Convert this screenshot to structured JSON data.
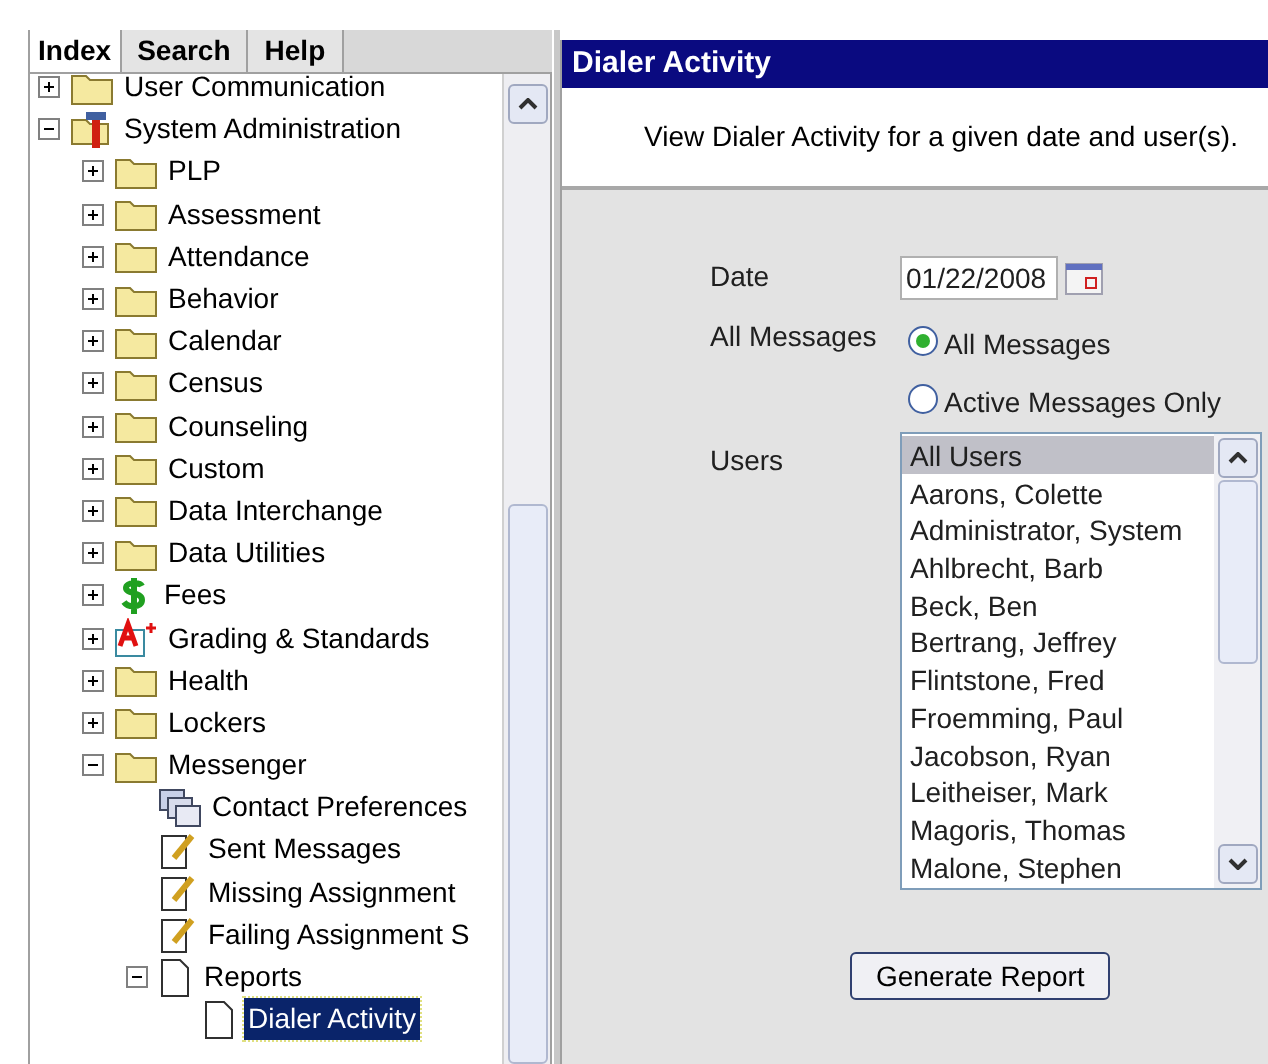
{
  "tabs": [
    {
      "label": "Index",
      "selected": true
    },
    {
      "label": "Search",
      "selected": false
    },
    {
      "label": "Help",
      "selected": false
    }
  ],
  "tree": [
    {
      "label": "User Communication",
      "kind": "folder",
      "expanded": false,
      "selected": false
    },
    {
      "label": "System Administration",
      "kind": "tools",
      "expanded": true,
      "selected": false,
      "children": [
        {
          "label": "PLP",
          "kind": "folder",
          "expanded": false,
          "selected": false
        },
        {
          "label": "Assessment",
          "kind": "folder",
          "expanded": false,
          "selected": false
        },
        {
          "label": "Attendance",
          "kind": "folder",
          "expanded": false,
          "selected": false
        },
        {
          "label": "Behavior",
          "kind": "folder",
          "expanded": false,
          "selected": false
        },
        {
          "label": "Calendar",
          "kind": "folder",
          "expanded": false,
          "selected": false
        },
        {
          "label": "Census",
          "kind": "folder",
          "expanded": false,
          "selected": false
        },
        {
          "label": "Counseling",
          "kind": "folder",
          "expanded": false,
          "selected": false
        },
        {
          "label": "Custom",
          "kind": "folder",
          "expanded": false,
          "selected": false
        },
        {
          "label": "Data Interchange",
          "kind": "folder",
          "expanded": false,
          "selected": false
        },
        {
          "label": "Data Utilities",
          "kind": "folder",
          "expanded": false,
          "selected": false
        },
        {
          "label": "Fees",
          "kind": "dollar",
          "expanded": false,
          "selected": false
        },
        {
          "label": "Grading & Standards",
          "kind": "grade",
          "expanded": false,
          "selected": false
        },
        {
          "label": "Health",
          "kind": "folder",
          "expanded": false,
          "selected": false
        },
        {
          "label": "Lockers",
          "kind": "folder",
          "expanded": false,
          "selected": false
        },
        {
          "label": "Messenger",
          "kind": "folder",
          "expanded": true,
          "selected": false,
          "children": [
            {
              "label": "Contact Preferences",
              "kind": "windows",
              "selected": false
            },
            {
              "label": "Sent Messages",
              "kind": "notepad",
              "selected": false
            },
            {
              "label": "Missing Assignment",
              "kind": "notepad",
              "selected": false
            },
            {
              "label": "Failing Assignment S",
              "kind": "notepad",
              "selected": false
            },
            {
              "label": "Reports",
              "kind": "document",
              "expanded": true,
              "selected": false,
              "children": [
                {
                  "label": "Dialer Activity",
                  "kind": "document",
                  "selected": true
                }
              ]
            }
          ]
        }
      ]
    }
  ],
  "panel": {
    "title": "Dialer Activity",
    "description": "View Dialer Activity for a given date and user(s).",
    "date": {
      "label": "Date",
      "value": "01/22/2008"
    },
    "messages": {
      "label": "All Messages",
      "options": [
        {
          "label": "All Messages",
          "selected": true
        },
        {
          "label": "Active Messages Only",
          "selected": false
        }
      ]
    },
    "users": {
      "label": "Users",
      "items": [
        {
          "label": "All Users",
          "selected": true
        },
        {
          "label": "Aarons, Colette",
          "selected": false
        },
        {
          "label": "Administrator, System",
          "selected": false
        },
        {
          "label": "Ahlbrecht, Barb",
          "selected": false
        },
        {
          "label": "Beck, Ben",
          "selected": false
        },
        {
          "label": "Bertrang, Jeffrey",
          "selected": false
        },
        {
          "label": "Flintstone, Fred",
          "selected": false
        },
        {
          "label": "Froemming, Paul",
          "selected": false
        },
        {
          "label": "Jacobson, Ryan",
          "selected": false
        },
        {
          "label": "Leitheiser, Mark",
          "selected": false
        },
        {
          "label": "Magoris, Thomas",
          "selected": false
        },
        {
          "label": "Malone, Stephen",
          "selected": false
        }
      ]
    },
    "button": "Generate Report"
  }
}
